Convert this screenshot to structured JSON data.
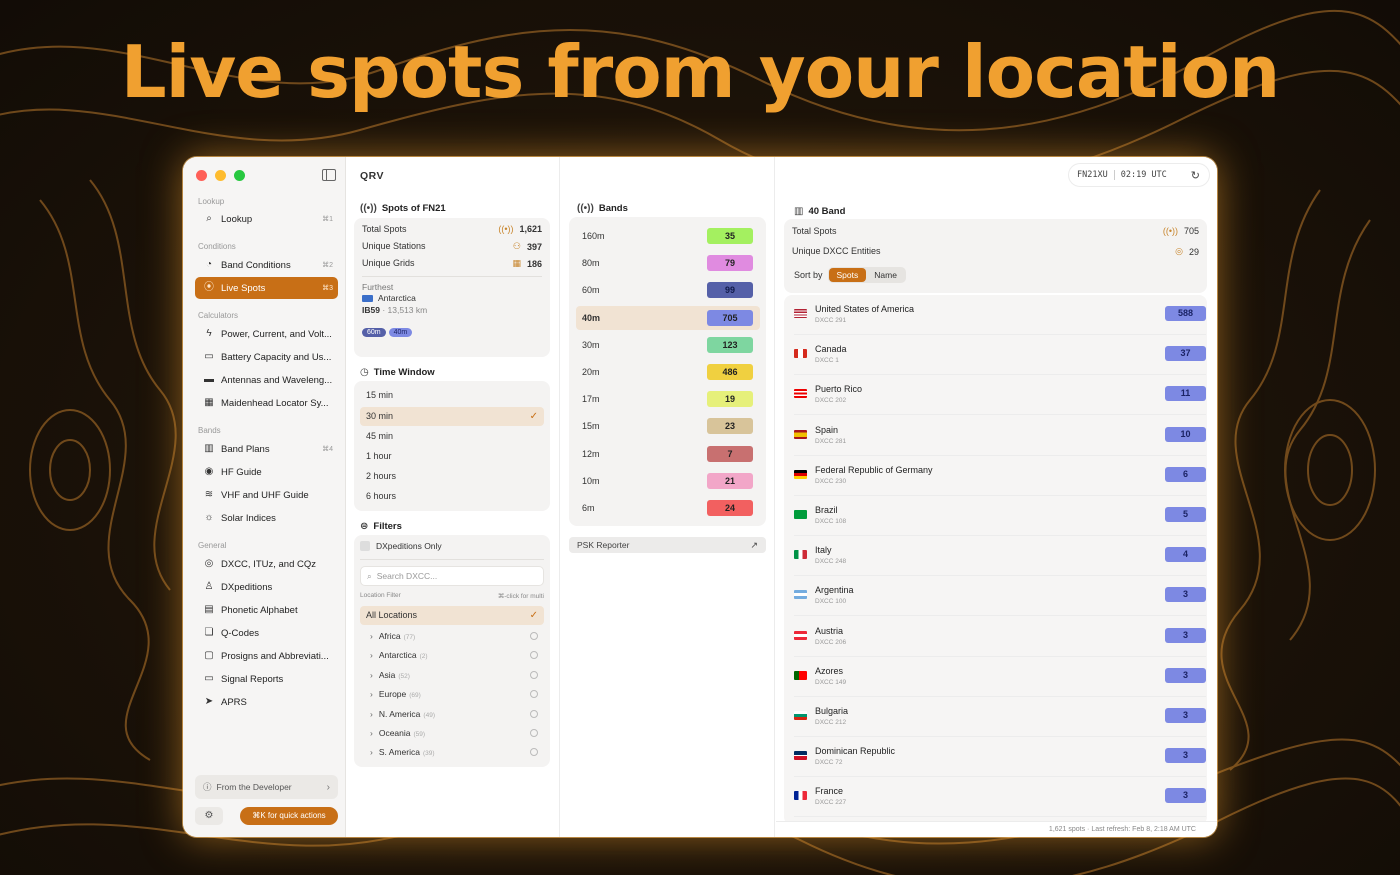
{
  "headline": "Live spots from your location",
  "colors": {
    "accent": "#c86f16",
    "headline": "#f0a030",
    "selected_row": "#f1e3d3",
    "entity_badge": "#7d89e3"
  },
  "sidebar": {
    "sections": {
      "lookup": "Lookup",
      "conditions": "Conditions",
      "calculators": "Calculators",
      "bands": "Bands",
      "general": "General"
    },
    "items": [
      {
        "label": "Lookup",
        "icon": "search-icon",
        "shortcut": "⌘1"
      },
      {
        "label": "Band Conditions",
        "icon": "gauge-icon",
        "shortcut": "⌘2"
      },
      {
        "label": "Live Spots",
        "icon": "antenna-icon",
        "shortcut": "⌘3",
        "active": true
      },
      {
        "label": "Power, Current, and Volt...",
        "icon": "bolt-icon",
        "shortcut": ""
      },
      {
        "label": "Battery Capacity and Us...",
        "icon": "battery-icon",
        "shortcut": ""
      },
      {
        "label": "Antennas and Waveleng...",
        "icon": "ruler-icon",
        "shortcut": ""
      },
      {
        "label": "Maidenhead Locator Sy...",
        "icon": "map-icon",
        "shortcut": ""
      },
      {
        "label": "Band Plans",
        "icon": "bars-icon",
        "shortcut": "⌘4"
      },
      {
        "label": "HF Guide",
        "icon": "broadcast-icon",
        "shortcut": ""
      },
      {
        "label": "VHF and UHF Guide",
        "icon": "waveform-icon",
        "shortcut": ""
      },
      {
        "label": "Solar Indices",
        "icon": "sun-icon",
        "shortcut": ""
      },
      {
        "label": "DXCC, ITUz, and CQz",
        "icon": "globe-icon",
        "shortcut": ""
      },
      {
        "label": "DXpeditions",
        "icon": "person-icon",
        "shortcut": ""
      },
      {
        "label": "Phonetic Alphabet",
        "icon": "book-icon",
        "shortcut": ""
      },
      {
        "label": "Q-Codes",
        "icon": "chat-icon",
        "shortcut": ""
      },
      {
        "label": "Prosigns and Abbreviati...",
        "icon": "abbrev-icon",
        "shortcut": ""
      },
      {
        "label": "Signal Reports",
        "icon": "report-icon",
        "shortcut": ""
      },
      {
        "label": "APRS",
        "icon": "send-icon",
        "shortcut": ""
      }
    ],
    "developer": "From the Developer",
    "quick_actions": "⌘K for quick actions"
  },
  "app_title": "QRV",
  "spots": {
    "title": "Spots of FN21",
    "total_label": "Total Spots",
    "total_value": "1,621",
    "stations_label": "Unique Stations",
    "stations_value": "397",
    "grids_label": "Unique Grids",
    "grids_value": "186",
    "furthest_label": "Furthest",
    "furthest_place": "Antarctica",
    "furthest_grid": "IB59",
    "furthest_dist": "· 13,513 km",
    "furthest_bands": [
      "60m",
      "40m"
    ]
  },
  "time_window": {
    "title": "Time Window",
    "options": [
      "15 min",
      "30 min",
      "45 min",
      "1 hour",
      "2 hours",
      "6 hours"
    ],
    "selected": 1
  },
  "filters": {
    "title": "Filters",
    "dxpeditions_only": "DXpeditions Only",
    "search_placeholder": "Search DXCC...",
    "location_filter_label": "Location Filter",
    "multi_hint": "⌘-click for multi",
    "all_locations": "All Locations",
    "continents": [
      {
        "name": "Africa",
        "count": "(77)"
      },
      {
        "name": "Antarctica",
        "count": "(2)"
      },
      {
        "name": "Asia",
        "count": "(52)"
      },
      {
        "name": "Europe",
        "count": "(69)"
      },
      {
        "name": "N. America",
        "count": "(49)"
      },
      {
        "name": "Oceania",
        "count": "(59)"
      },
      {
        "name": "S. America",
        "count": "(39)"
      }
    ]
  },
  "bands": {
    "title": "Bands",
    "rows": [
      {
        "name": "160m",
        "count": "35",
        "color": "#a4f060"
      },
      {
        "name": "80m",
        "count": "79",
        "color": "#e08be0"
      },
      {
        "name": "60m",
        "count": "99",
        "color": "#5560a8"
      },
      {
        "name": "40m",
        "count": "705",
        "color": "#7d89e3"
      },
      {
        "name": "30m",
        "count": "123",
        "color": "#7ed6a0"
      },
      {
        "name": "20m",
        "count": "486",
        "color": "#f0d040"
      },
      {
        "name": "17m",
        "count": "19",
        "color": "#e6f07a"
      },
      {
        "name": "15m",
        "count": "23",
        "color": "#d8c49a"
      },
      {
        "name": "12m",
        "count": "7",
        "color": "#c87070"
      },
      {
        "name": "10m",
        "count": "21",
        "color": "#f2a6c8"
      },
      {
        "name": "6m",
        "count": "24",
        "color": "#f26060"
      }
    ],
    "selected": 3,
    "psk_reporter": "PSK Reporter"
  },
  "status": {
    "grid": "FN21XU",
    "time": "02:19 UTC"
  },
  "band_detail": {
    "title": "40 Band",
    "total_label": "Total Spots",
    "total_value": "705",
    "entities_label": "Unique DXCC Entities",
    "entities_value": "29",
    "sort_label": "Sort by",
    "sort_spots": "Spots",
    "sort_name": "Name",
    "entities": [
      {
        "name": "United States of America",
        "dxcc": "DXCC 291",
        "count": "588"
      },
      {
        "name": "Canada",
        "dxcc": "DXCC 1",
        "count": "37"
      },
      {
        "name": "Puerto Rico",
        "dxcc": "DXCC 202",
        "count": "11"
      },
      {
        "name": "Spain",
        "dxcc": "DXCC 281",
        "count": "10"
      },
      {
        "name": "Federal Republic of Germany",
        "dxcc": "DXCC 230",
        "count": "6"
      },
      {
        "name": "Brazil",
        "dxcc": "DXCC 108",
        "count": "5"
      },
      {
        "name": "Italy",
        "dxcc": "DXCC 248",
        "count": "4"
      },
      {
        "name": "Argentina",
        "dxcc": "DXCC 100",
        "count": "3"
      },
      {
        "name": "Austria",
        "dxcc": "DXCC 206",
        "count": "3"
      },
      {
        "name": "Azores",
        "dxcc": "DXCC 149",
        "count": "3"
      },
      {
        "name": "Bulgaria",
        "dxcc": "DXCC 212",
        "count": "3"
      },
      {
        "name": "Dominican Republic",
        "dxcc": "DXCC 72",
        "count": "3"
      },
      {
        "name": "France",
        "dxcc": "DXCC 227",
        "count": "3"
      }
    ]
  },
  "footer": "1,621 spots · Last refresh: Feb 8, 2:18 AM UTC"
}
